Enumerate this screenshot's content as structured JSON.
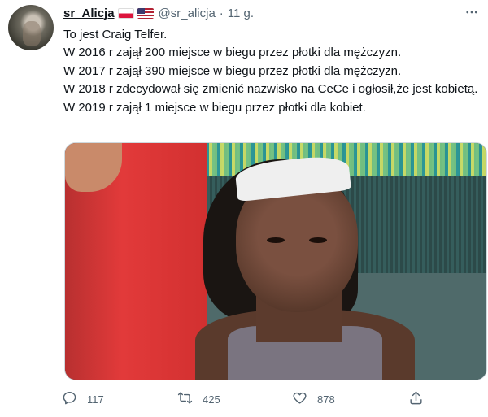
{
  "tweet": {
    "author": {
      "display_name": "sr_Alicja",
      "flags": [
        "poland-flag",
        "usa-flag"
      ],
      "handle": "@sr_alicja",
      "separator": "·",
      "time": "11 g."
    },
    "more_icon": "more-icon",
    "text_lines": [
      "To jest Craig Telfer.",
      "W 2016 r zajął 200 miejsce w biegu przez płotki dla mężczyzn.",
      "W 2017 r zajął 390 miejsce w biegu przez płotki dla mężczyzn.",
      "W 2018 r zdecydował się zmienić nazwisko na CeCe i ogłosił,że jest kobietą.",
      "W 2019 r zajął 1 miejsce w biegu przez płotki dla kobiet."
    ],
    "actions": {
      "reply": {
        "icon": "reply-icon",
        "count": "117"
      },
      "retweet": {
        "icon": "retweet-icon",
        "count": "425"
      },
      "like": {
        "icon": "heart-icon",
        "count": "878"
      },
      "share": {
        "icon": "share-icon"
      }
    }
  },
  "colors": {
    "text_primary": "#0f1419",
    "text_secondary": "#536471",
    "border": "#cfd9de"
  }
}
